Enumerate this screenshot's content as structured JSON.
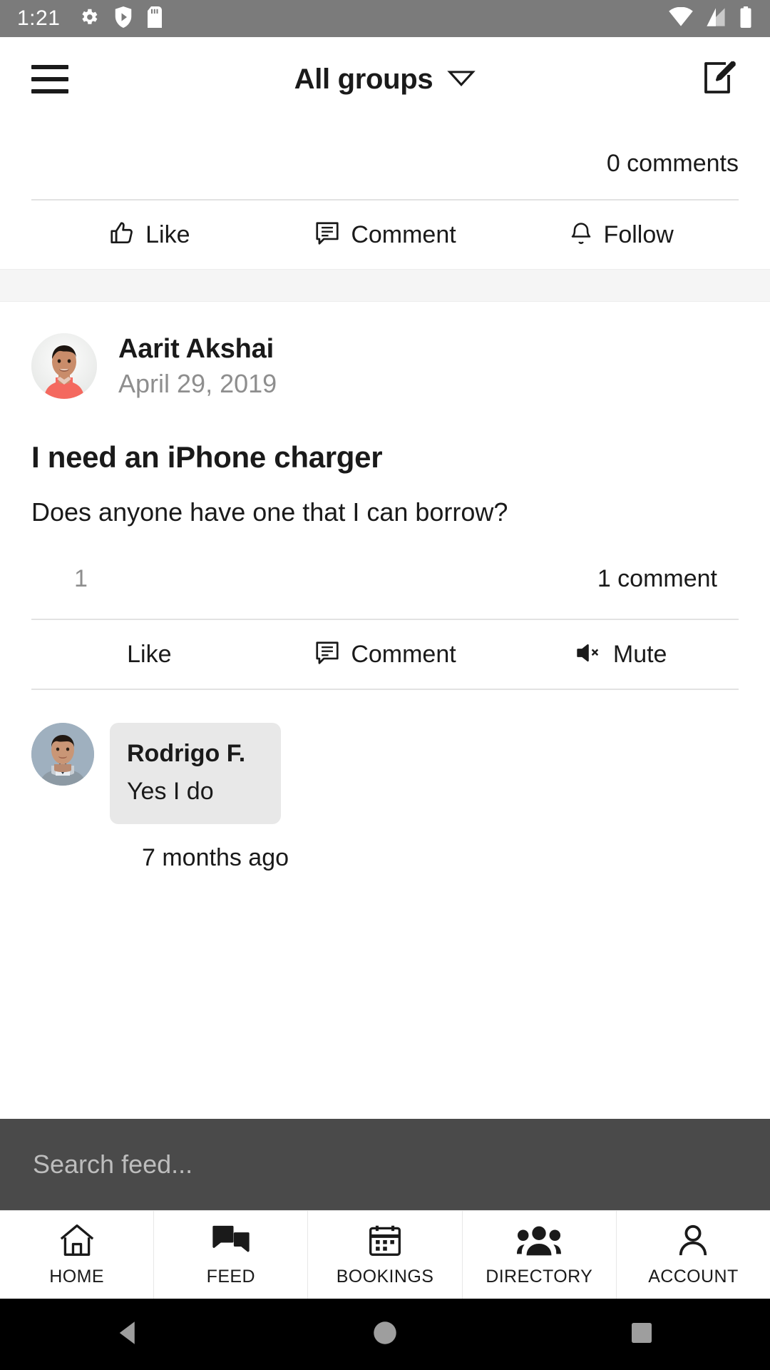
{
  "status_bar": {
    "time": "1:21",
    "left_icons": [
      "gear-icon",
      "shield-play-icon",
      "sd-card-icon"
    ],
    "right_icons": [
      "wifi-icon",
      "cellular-signal-icon",
      "battery-icon"
    ],
    "background_color": "#7b7b7b"
  },
  "header": {
    "menu_icon": "hamburger-menu-icon",
    "title": "All groups",
    "dropdown_icon": "caret-down-icon",
    "compose_icon": "compose-post-icon"
  },
  "previous_post": {
    "comments_count": "0 comments",
    "actions": [
      {
        "label": "Like",
        "icon": "thumbs-up-icon"
      },
      {
        "label": "Comment",
        "icon": "comment-lines-icon"
      },
      {
        "label": "Follow",
        "icon": "bell-icon"
      }
    ]
  },
  "post": {
    "author_name": "Aarit Akshai",
    "author_date": "April 29, 2019",
    "avatar": "avatar-aarit-akshai",
    "title": "I need an iPhone charger",
    "body": "Does anyone have one that I can borrow?",
    "like_count": "1",
    "comment_count": "1 comment",
    "actions": [
      {
        "label": "Like",
        "icon": "none"
      },
      {
        "label": "Comment",
        "icon": "comment-lines-icon"
      },
      {
        "label": "Mute",
        "icon": "speaker-mute-icon"
      }
    ],
    "comments": [
      {
        "avatar": "avatar-rodrigo-f",
        "name": "Rodrigo F.",
        "text": "Yes I do",
        "time": "7 months ago"
      }
    ]
  },
  "search": {
    "placeholder": "Search feed...",
    "icon": "search-icon",
    "background_color": "#4a4a4a"
  },
  "bottom_nav": {
    "items": [
      {
        "label": "HOME",
        "icon": "home-icon"
      },
      {
        "label": "FEED",
        "icon": "chat-bubbles-icon"
      },
      {
        "label": "BOOKINGS",
        "icon": "calendar-icon"
      },
      {
        "label": "DIRECTORY",
        "icon": "people-group-icon"
      },
      {
        "label": "ACCOUNT",
        "icon": "person-icon"
      }
    ]
  },
  "android_nav": {
    "back": "back-triangle-icon",
    "home": "home-circle-icon",
    "recents": "recents-square-icon"
  },
  "colors": {
    "text_primary": "#1a1a1a",
    "text_muted": "#8e8e8e",
    "divider": "#e2e2e2",
    "bubble": "#e8e8e8",
    "post_gap": "#f5f5f5"
  }
}
